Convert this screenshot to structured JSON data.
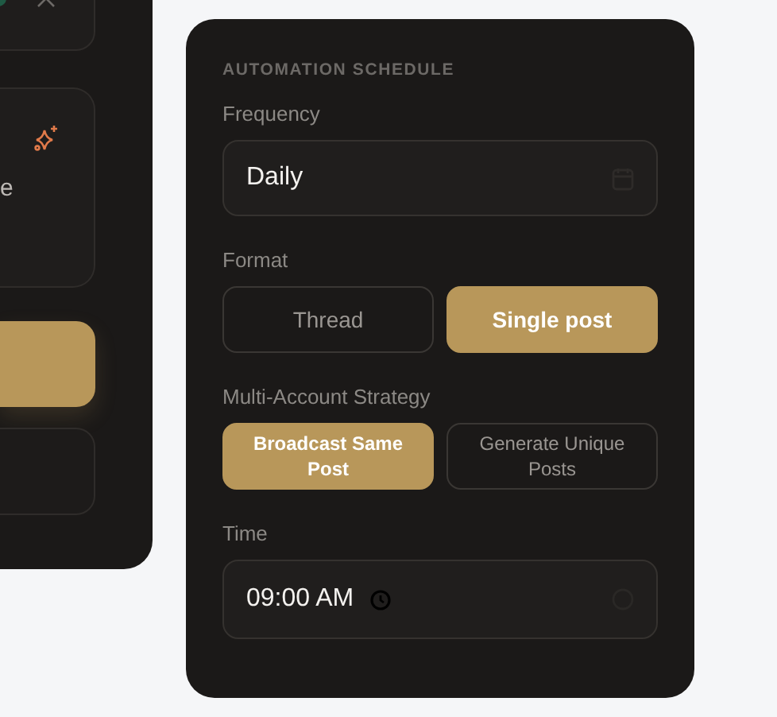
{
  "left_panel": {
    "partial_text": "e",
    "primary_button": {
      "kind": "gold"
    }
  },
  "schedule": {
    "title": "AUTOMATION SCHEDULE",
    "frequency": {
      "label": "Frequency",
      "value": "Daily"
    },
    "format": {
      "label": "Format",
      "options": [
        {
          "label": "Thread",
          "selected": false
        },
        {
          "label": "Single post",
          "selected": true
        }
      ]
    },
    "strategy": {
      "label": "Multi-Account Strategy",
      "options": [
        {
          "label": "Broadcast Same Post",
          "selected": true
        },
        {
          "label": "Generate Unique Posts",
          "selected": false
        }
      ]
    },
    "time": {
      "label": "Time",
      "value": "09:00 AM"
    }
  }
}
